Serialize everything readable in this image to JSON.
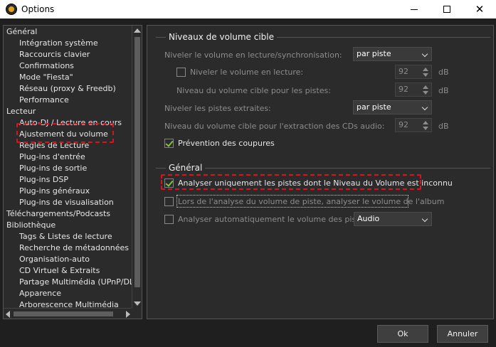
{
  "window": {
    "title": "Options",
    "icon": "app-logo-icon"
  },
  "tree": {
    "items": [
      {
        "label": "Général",
        "level": 0
      },
      {
        "label": "Intégration système",
        "level": 1
      },
      {
        "label": "Raccourcis clavier",
        "level": 1
      },
      {
        "label": "Confirmations",
        "level": 1
      },
      {
        "label": "Mode \"Fiesta\"",
        "level": 1
      },
      {
        "label": "Réseau (proxy & Freedb)",
        "level": 1
      },
      {
        "label": "Performance",
        "level": 1
      },
      {
        "label": "Lecteur",
        "level": 0
      },
      {
        "label": "Auto-DJ / Lecture en cours",
        "level": 1
      },
      {
        "label": "Ajustement du volume",
        "level": 1,
        "selected": true
      },
      {
        "label": "Règles de Lecture",
        "level": 1
      },
      {
        "label": "Plug-ins d'entrée",
        "level": 1
      },
      {
        "label": "Plug-ins de sortie",
        "level": 1
      },
      {
        "label": "Plug-ins DSP",
        "level": 1
      },
      {
        "label": "Plug-ins généraux",
        "level": 1
      },
      {
        "label": "Plug-ins de visualisation",
        "level": 1
      },
      {
        "label": "Téléchargements/Podcasts",
        "level": 0
      },
      {
        "label": "Bibliothèque",
        "level": 0
      },
      {
        "label": "Tags & Listes de lecture",
        "level": 1
      },
      {
        "label": "Recherche de métadonnées",
        "level": 1
      },
      {
        "label": "Organisation-auto",
        "level": 1
      },
      {
        "label": "CD Virtuel & Extraits",
        "level": 1
      },
      {
        "label": "Partage Multimédia (UPnP/DLNA)",
        "level": 1
      },
      {
        "label": "Apparence",
        "level": 1
      },
      {
        "label": "Arborescence Multimédia",
        "level": 1
      }
    ]
  },
  "volume_group": {
    "title": "Niveaux de volume cible",
    "level_playback_label": "Niveler le volume en lecture/synchronisation:",
    "level_playback_value": "par piste",
    "level_volume_checkbox_label": "Niveler le volume en lecture:",
    "level_volume_checked": false,
    "level_volume_value": "92",
    "target_tracks_label": "Niveau du volume cible pour les pistes:",
    "target_tracks_value": "92",
    "extracted_label": "Niveler les pistes extraites:",
    "extracted_value": "par piste",
    "target_cd_label": "Niveau du volume cible pour l'extraction des CDs audio:",
    "target_cd_value": "92",
    "unit_db": "dB",
    "clip_prevention_label": "Prévention des coupures",
    "clip_prevention_checked": true
  },
  "general_group": {
    "title": "Général",
    "analyze_unknown_label": "Analyser uniquement les pistes dont le Niveau du Volume est inconnu",
    "analyze_unknown_checked": true,
    "album_volume_label": "Lors de l'analyse du volume de piste, analyser le volume de l'album",
    "album_volume_checked": false,
    "auto_analyze_label": "Analyser automatiquement le volume des pistes non",
    "auto_analyze_checked": false,
    "auto_analyze_value": "Audio"
  },
  "buttons": {
    "ok": "Ok",
    "cancel": "Annuler"
  },
  "colors": {
    "background": "#1f1f1f",
    "panel": "#2b2b2b",
    "highlight": "#e0101e",
    "check": "#7ec14a"
  }
}
